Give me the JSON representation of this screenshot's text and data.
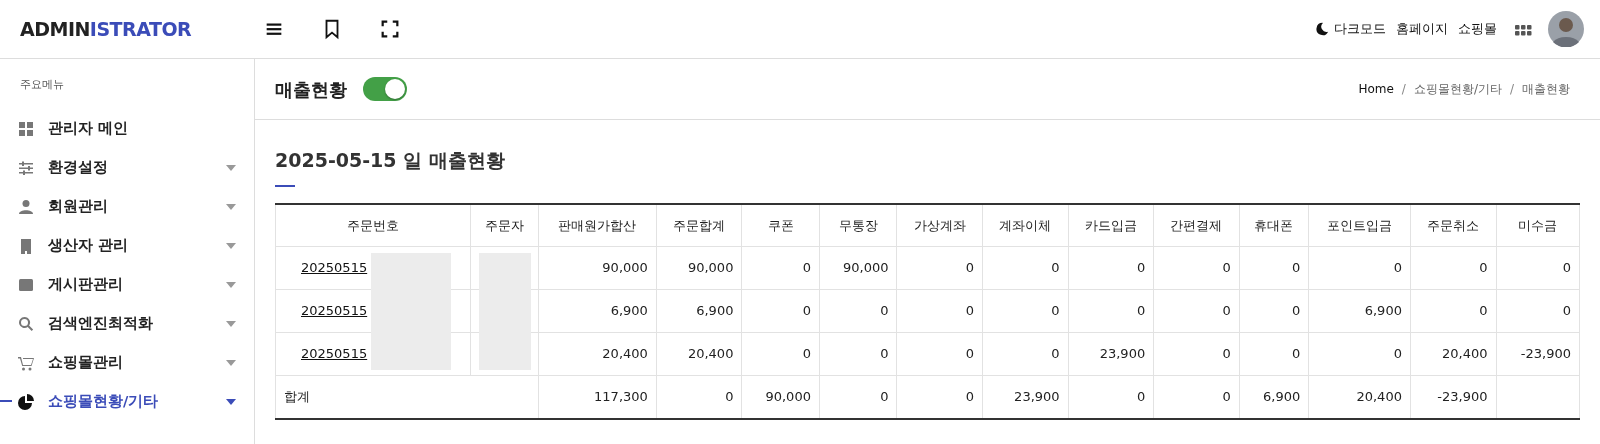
{
  "brand": {
    "part1": "ADMIN",
    "part2": "ISTRATOR"
  },
  "top_links": [
    {
      "kind": "dark-mode",
      "label": "다크모드"
    },
    {
      "kind": "link",
      "label": "홈페이지"
    },
    {
      "kind": "link",
      "label": "쇼핑몰"
    }
  ],
  "sidebar": {
    "heading": "주요메뉴",
    "items": [
      {
        "label": "관리자 메인",
        "has_submenu": false,
        "selected": false
      },
      {
        "label": "환경설정",
        "has_submenu": true,
        "selected": false
      },
      {
        "label": "회원관리",
        "has_submenu": true,
        "selected": false
      },
      {
        "label": "생산자 관리",
        "has_submenu": true,
        "selected": false
      },
      {
        "label": "게시판관리",
        "has_submenu": true,
        "selected": false
      },
      {
        "label": "검색엔진최적화",
        "has_submenu": true,
        "selected": false
      },
      {
        "label": "쇼핑몰관리",
        "has_submenu": true,
        "selected": false
      },
      {
        "label": "쇼핑몰현황/기타",
        "has_submenu": true,
        "selected": true
      }
    ]
  },
  "page": {
    "title": "매출현황",
    "toggle_on": true,
    "breadcrumb": [
      {
        "kind": "link",
        "text": "Home"
      },
      {
        "kind": "separator",
        "text": "/"
      },
      {
        "kind": "link",
        "text": "쇼핑몰현황/기타"
      },
      {
        "kind": "separator",
        "text": "/"
      },
      {
        "kind": "current",
        "text": "매출현황"
      }
    ]
  },
  "report": {
    "title": "2025-05-15 일 매출현황",
    "table": {
      "columns": [
        "주문번호",
        "주문자",
        "판매원가합산",
        "주문합계",
        "쿠폰",
        "무통장",
        "가상계좌",
        "계좌이체",
        "카드입금",
        "간편결제",
        "휴대폰",
        "포인트입금",
        "주문취소",
        "미수금"
      ],
      "redacted": true,
      "rows": [
        {
          "cells": [
            "20250515",
            "",
            "90,000",
            "90,000",
            "0",
            "90,000",
            "0",
            "0",
            "0",
            "0",
            "0",
            "0",
            "0",
            "0"
          ]
        },
        {
          "cells": [
            "20250515",
            "",
            "6,900",
            "6,900",
            "0",
            "0",
            "0",
            "0",
            "0",
            "0",
            "0",
            "6,900",
            "0",
            "0"
          ]
        },
        {
          "cells": [
            "20250515",
            "",
            "20,400",
            "20,400",
            "0",
            "0",
            "0",
            "0",
            "23,900",
            "0",
            "0",
            "0",
            "20,400",
            "-23,900"
          ]
        }
      ],
      "total": {
        "cells": [
          "합계",
          "",
          "117,300",
          "0",
          "90,000",
          "0",
          "0",
          "23,900",
          "0",
          "0",
          "6,900",
          "20,400",
          "-23,900",
          ""
        ]
      }
    }
  }
}
